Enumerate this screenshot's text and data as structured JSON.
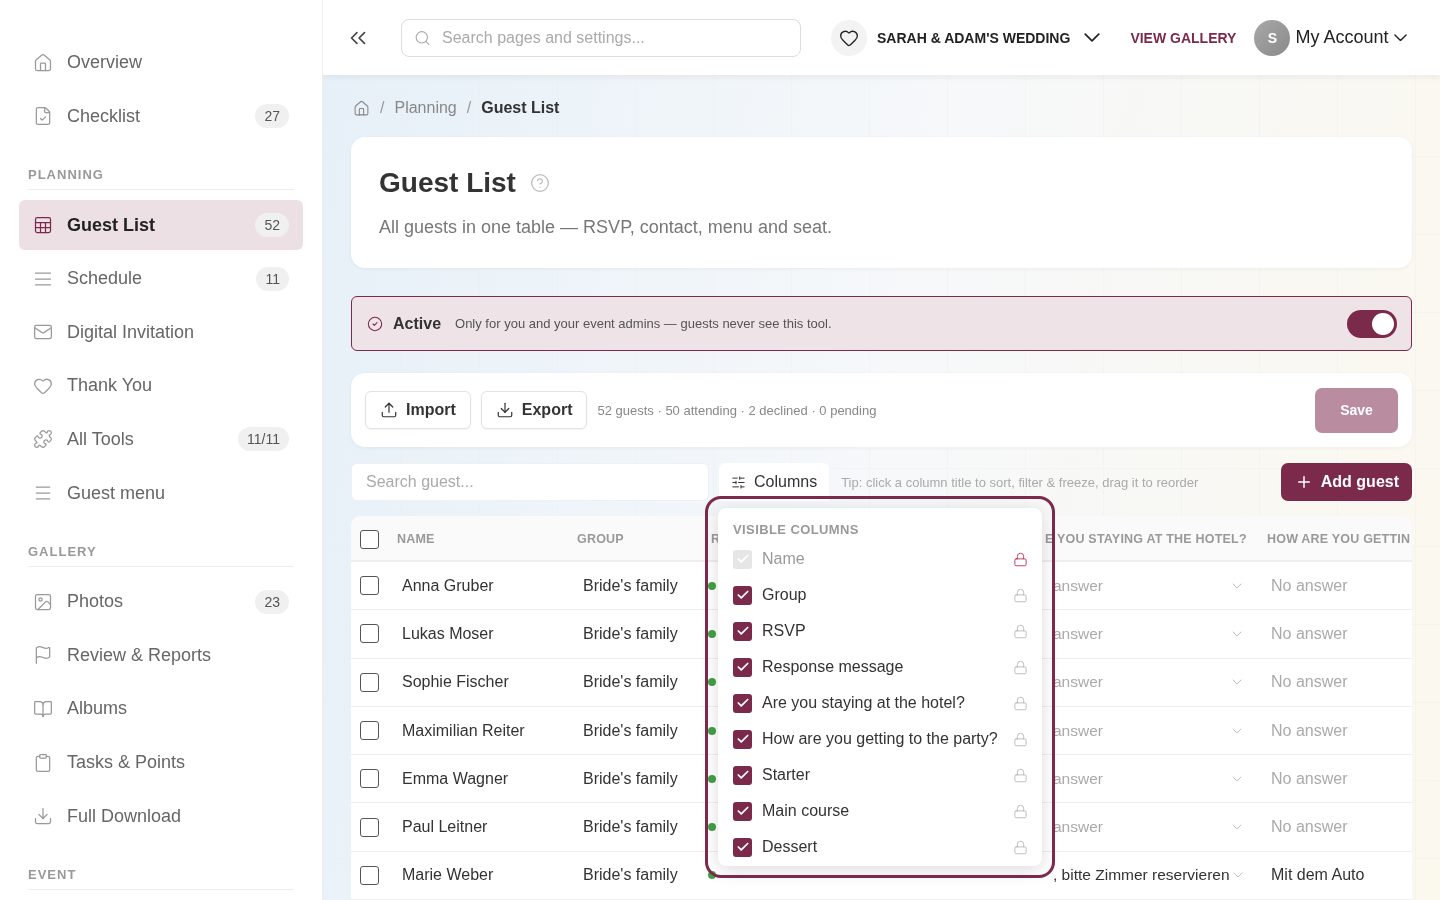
{
  "sidebar": {
    "sections": [
      {
        "items": [
          {
            "label": "Overview",
            "selected": false
          },
          {
            "label": "Checklist",
            "count": "27",
            "selected": false
          }
        ]
      },
      {
        "heading": "PLANNING",
        "items": [
          {
            "label": "Guest List",
            "count": "52",
            "selected": true
          },
          {
            "label": "Schedule",
            "count": "11",
            "selected": false
          },
          {
            "label": "Digital Invitation",
            "selected": false
          },
          {
            "label": "Thank You",
            "selected": false
          },
          {
            "label": "All Tools",
            "count": "11/11",
            "selected": false
          },
          {
            "label": "Guest menu",
            "selected": false
          }
        ]
      },
      {
        "heading": "GALLERY",
        "items": [
          {
            "label": "Photos",
            "count": "23",
            "selected": false
          },
          {
            "label": "Review & Reports",
            "selected": false
          },
          {
            "label": "Albums",
            "selected": false
          },
          {
            "label": "Tasks & Points",
            "selected": false
          },
          {
            "label": "Full Download",
            "selected": false
          }
        ]
      },
      {
        "heading": "EVENT"
      }
    ]
  },
  "topbar": {
    "search_placeholder": "Search pages and settings...",
    "event": "SARAH & ADAM'S WEDDING",
    "view_gallery": "VIEW GALLERY",
    "avatar": "S",
    "account": "My Account"
  },
  "breadcrumb": {
    "separator": "/",
    "items": [
      "Planning",
      "Guest List"
    ]
  },
  "header": {
    "title": "Guest List",
    "subtitle": "All guests in one table — RSVP, contact, menu and seat."
  },
  "banner": {
    "label": "Active",
    "text": "Only for you and your event admins — guests never see this tool.",
    "on": true
  },
  "toolbar": {
    "import": "Import",
    "export": "Export",
    "stats": "52 guests · 50 attending · 2 declined · 0 pending",
    "save": "Save",
    "save_disabled": true
  },
  "filters": {
    "search_placeholder": "Search guest...",
    "columns": "Columns",
    "tip": "Tip: click a column title to sort, filter & freeze, drag it to reorder",
    "add": "Add guest"
  },
  "table": {
    "all_selected": false,
    "columns": [
      "NAME",
      "GROUP",
      "R",
      "E YOU STAYING AT THE HOTEL?",
      "HOW ARE YOU GETTIN"
    ],
    "rows": [
      {
        "name": "Anna Gruber",
        "group": "Bride's family",
        "color": "#43a047",
        "hotel": "answer",
        "travel": "No answer",
        "answered": false,
        "selected": false
      },
      {
        "name": "Lukas Moser",
        "group": "Bride's family",
        "color": "#43a047",
        "hotel": "answer",
        "travel": "No answer",
        "answered": false,
        "selected": false
      },
      {
        "name": "Sophie Fischer",
        "group": "Bride's family",
        "color": "#43a047",
        "hotel": "answer",
        "travel": "No answer",
        "answered": false,
        "selected": false
      },
      {
        "name": "Maximilian Reiter",
        "group": "Bride's family",
        "color": "#43a047",
        "hotel": "answer",
        "travel": "No answer",
        "answered": false,
        "selected": false
      },
      {
        "name": "Emma Wagner",
        "group": "Bride's family",
        "color": "#43a047",
        "hotel": "answer",
        "travel": "No answer",
        "answered": false,
        "selected": false
      },
      {
        "name": "Paul Leitner",
        "group": "Bride's family",
        "color": "#43a047",
        "hotel": "answer",
        "travel": "No answer",
        "answered": false,
        "selected": false
      },
      {
        "name": "Marie Weber",
        "group": "Bride's family",
        "color": "#43a047",
        "hotel": ", bitte Zimmer reservieren",
        "travel": "Mit dem Auto",
        "answered": true,
        "selected": false
      }
    ]
  },
  "columns_menu": {
    "heading": "VISIBLE COLUMNS",
    "items": [
      {
        "label": "Name",
        "checked": true,
        "locked": true
      },
      {
        "label": "Group",
        "checked": true,
        "locked": false
      },
      {
        "label": "RSVP",
        "checked": true,
        "locked": false
      },
      {
        "label": "Response message",
        "checked": true,
        "locked": false
      },
      {
        "label": "Are you staying at the hotel?",
        "checked": true,
        "locked": false
      },
      {
        "label": "How are you getting to the party?",
        "checked": true,
        "locked": false
      },
      {
        "label": "Starter",
        "checked": true,
        "locked": false
      },
      {
        "label": "Main course",
        "checked": true,
        "locked": false
      },
      {
        "label": "Dessert",
        "checked": true,
        "locked": false
      }
    ]
  }
}
